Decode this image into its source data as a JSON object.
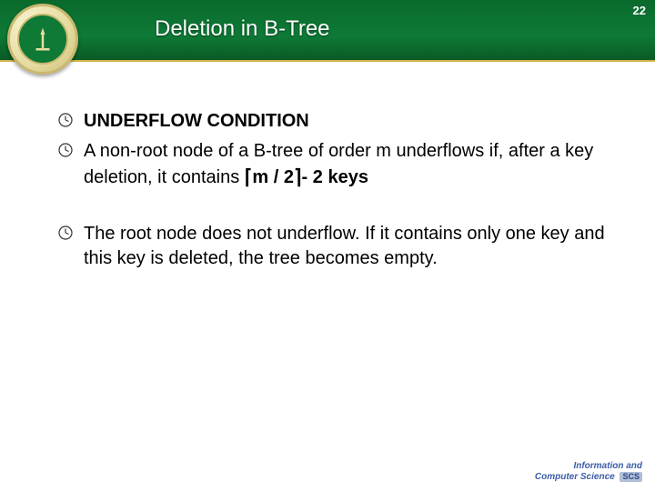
{
  "header": {
    "title": "Deletion in B-Tree",
    "page_number": "22"
  },
  "bullets": {
    "b1": "UNDERFLOW CONDITION",
    "b2_pre": "A non-root node of a B-tree of order m underflows if, after a key deletion, it contains ",
    "b2_expr": "m / 2",
    "b2_post": "- 2 keys",
    "b3": "The root node does not underflow. If it contains only one key and this key is deleted, the tree becomes empty."
  },
  "icons": {
    "bullet": "clock-icon",
    "logo": "university-seal-icon"
  },
  "footer": {
    "line1": "Information and",
    "line2": "Computer Science",
    "badge": "SCS"
  },
  "colors": {
    "header_green": "#0e7a36",
    "accent_gold": "#d4b24a"
  }
}
